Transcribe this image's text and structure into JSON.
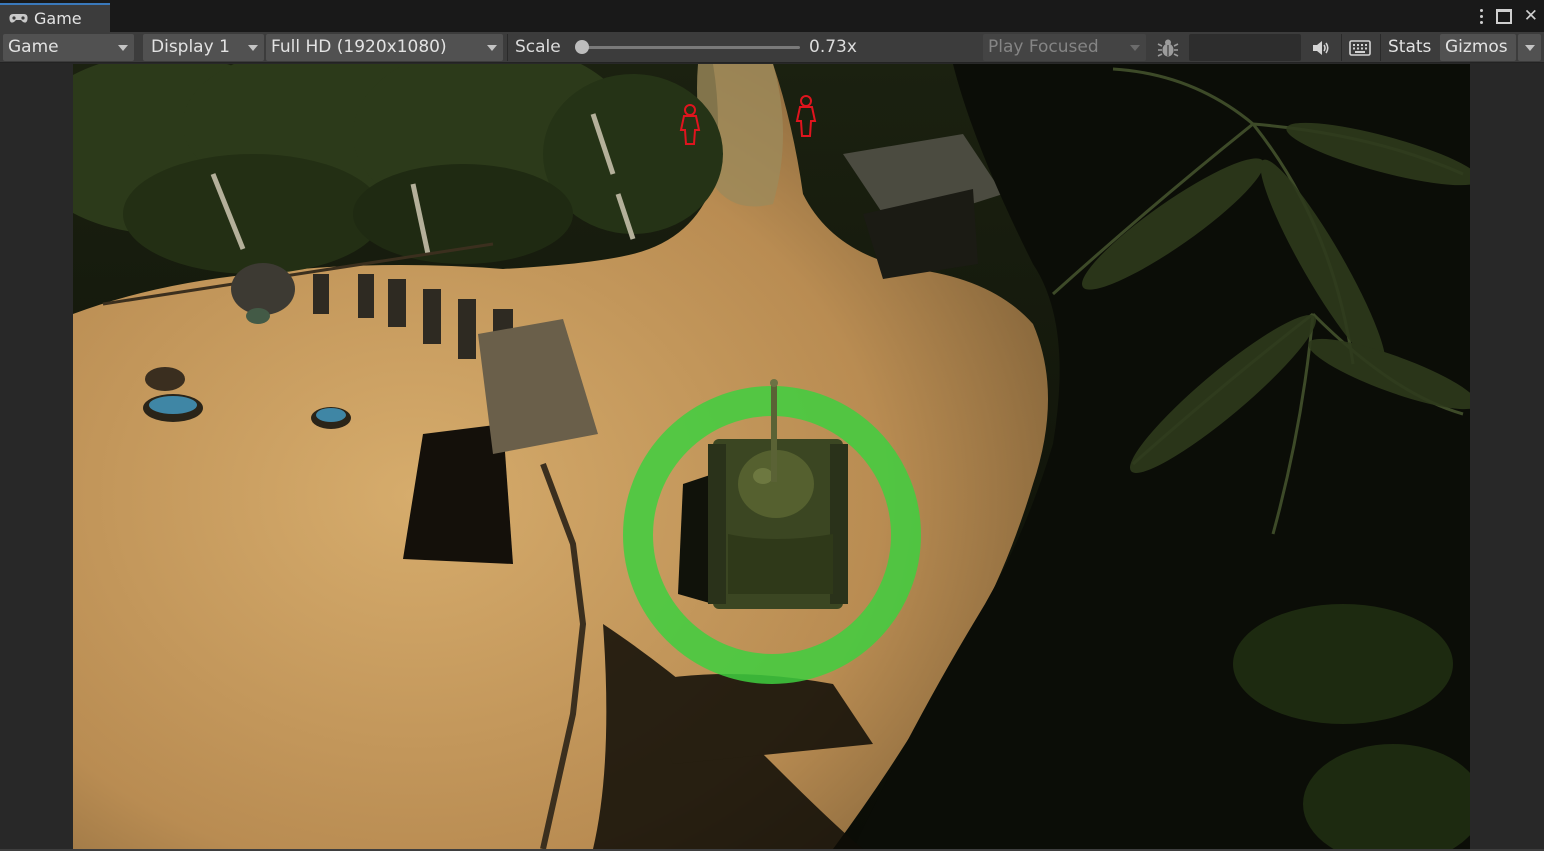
{
  "window": {
    "tab_title": "Game",
    "tab_icon": "gamepad-icon",
    "menu_icon": "kebab-menu-icon",
    "maximize_icon": "maximize-icon",
    "close_icon": "close-icon"
  },
  "toolbar": {
    "view_mode": "Game",
    "display": "Display 1",
    "resolution": "Full HD (1920x1080)",
    "scale_label": "Scale",
    "scale_value": "0.73x",
    "scale_fraction": 0.0,
    "play_mode": "Play Focused",
    "debug_icon": "bug-icon",
    "audio_icon": "speaker-icon",
    "keyboard_icon": "keyboard-icon",
    "stats_label": "Stats",
    "gizmos_label": "Gizmos"
  },
  "scene": {
    "selection_ring_color": "#3fcf3f",
    "enemy_outline_color": "#e0141e",
    "ground_color": "#c9a066",
    "foliage_color": "#2f3a1c"
  }
}
